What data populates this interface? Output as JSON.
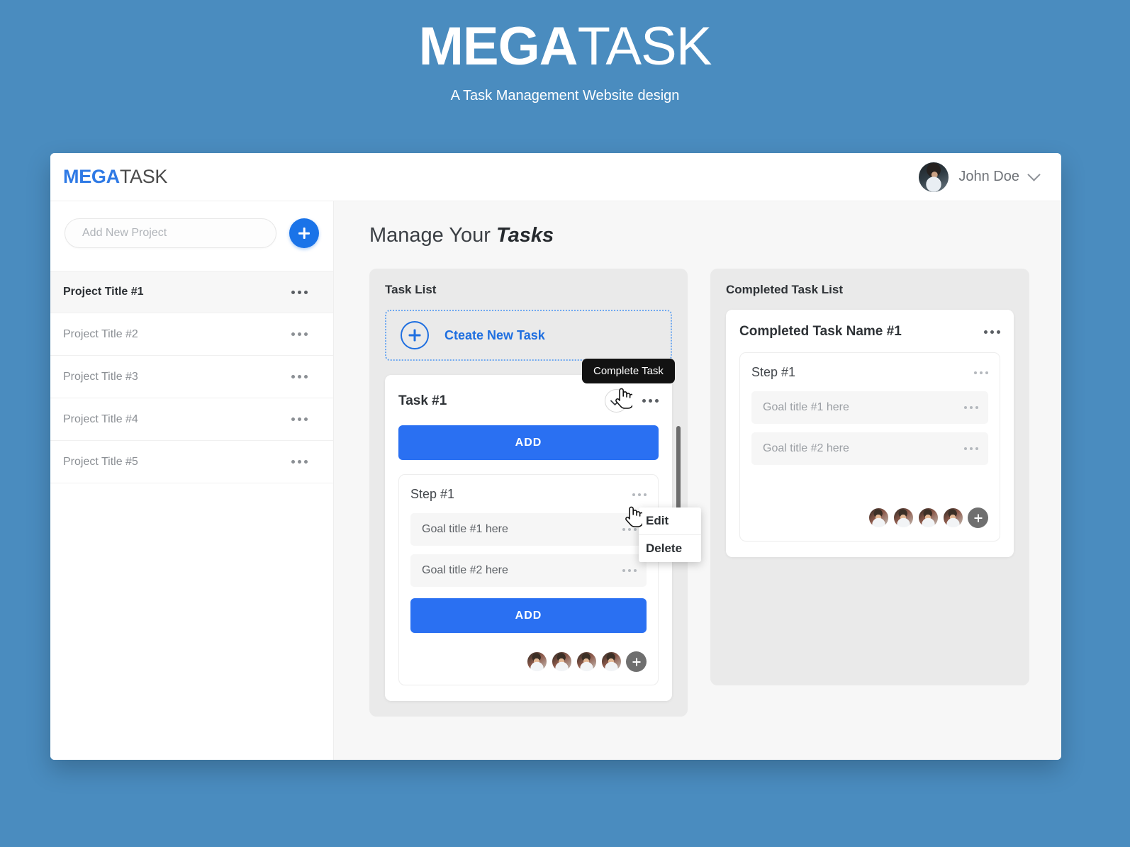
{
  "hero": {
    "title_bold": "MEGA",
    "title_light": "TASK",
    "subtitle": "A Task Management Website design"
  },
  "colors": {
    "page_background": "#4a8cbf",
    "brand_blue": "#2f7ae5",
    "accent_blue": "#2a70f2",
    "add_button_blue": "#1a73e8",
    "panel_gray": "#eaeaea",
    "content_gray": "#f7f7f7",
    "tooltip_black": "#121212",
    "member_add_gray": "#6f6f6f"
  },
  "topbar": {
    "brand_bold": "MEGA",
    "brand_light": "TASK",
    "user_name": "John Doe",
    "avatar_icon": "user-avatar-photo",
    "chevron_icon": "chevron-down-icon"
  },
  "sidebar": {
    "new_project_placeholder": "Add New Project",
    "new_project_value": "",
    "add_button_icon": "plus-icon",
    "projects": [
      {
        "label": "Project Title #1",
        "active": true,
        "menu_icon": "more-options-icon"
      },
      {
        "label": "Project Title #2",
        "active": false,
        "menu_icon": "more-options-icon"
      },
      {
        "label": "Project Title #3",
        "active": false,
        "menu_icon": "more-options-icon"
      },
      {
        "label": "Project Title #4",
        "active": false,
        "menu_icon": "more-options-icon"
      },
      {
        "label": "Project Title #5",
        "active": false,
        "menu_icon": "more-options-icon"
      }
    ]
  },
  "main": {
    "page_title_normal": "Manage Your ",
    "page_title_emphasis": "Tasks"
  },
  "task_panel": {
    "title": "Task List",
    "create_task_label": "Cteate New Task",
    "create_task_icon": "plus-circle-icon",
    "task": {
      "title": "Task #1",
      "complete_icon": "check-circle-icon",
      "menu_icon": "more-options-icon",
      "add_button_label": "ADD",
      "step": {
        "title": "Step #1",
        "menu_icon": "more-options-icon",
        "goals": [
          {
            "label": "Goal title #1 here",
            "menu_icon": "more-options-icon"
          },
          {
            "label": "Goal title #2 here",
            "menu_icon": "more-options-icon"
          }
        ],
        "add_button_label": "ADD"
      },
      "members_count": 4,
      "member_add_icon": "plus-icon"
    }
  },
  "completed_panel": {
    "title": "Completed Task List",
    "task": {
      "title": "Completed Task Name #1",
      "menu_icon": "more-options-icon",
      "step": {
        "title": "Step #1",
        "menu_icon": "more-options-icon",
        "goals": [
          {
            "label": "Goal title #1 here",
            "menu_icon": "more-options-icon"
          },
          {
            "label": "Goal title #2 here",
            "menu_icon": "more-options-icon"
          }
        ]
      },
      "members_count": 4,
      "member_add_icon": "plus-icon"
    }
  },
  "overlays": {
    "tooltip_text": "Complete Task",
    "context_menu": {
      "items": [
        {
          "label": "Edit"
        },
        {
          "label": "Delete"
        }
      ]
    },
    "cursor_icon": "pointing-hand-cursor"
  }
}
